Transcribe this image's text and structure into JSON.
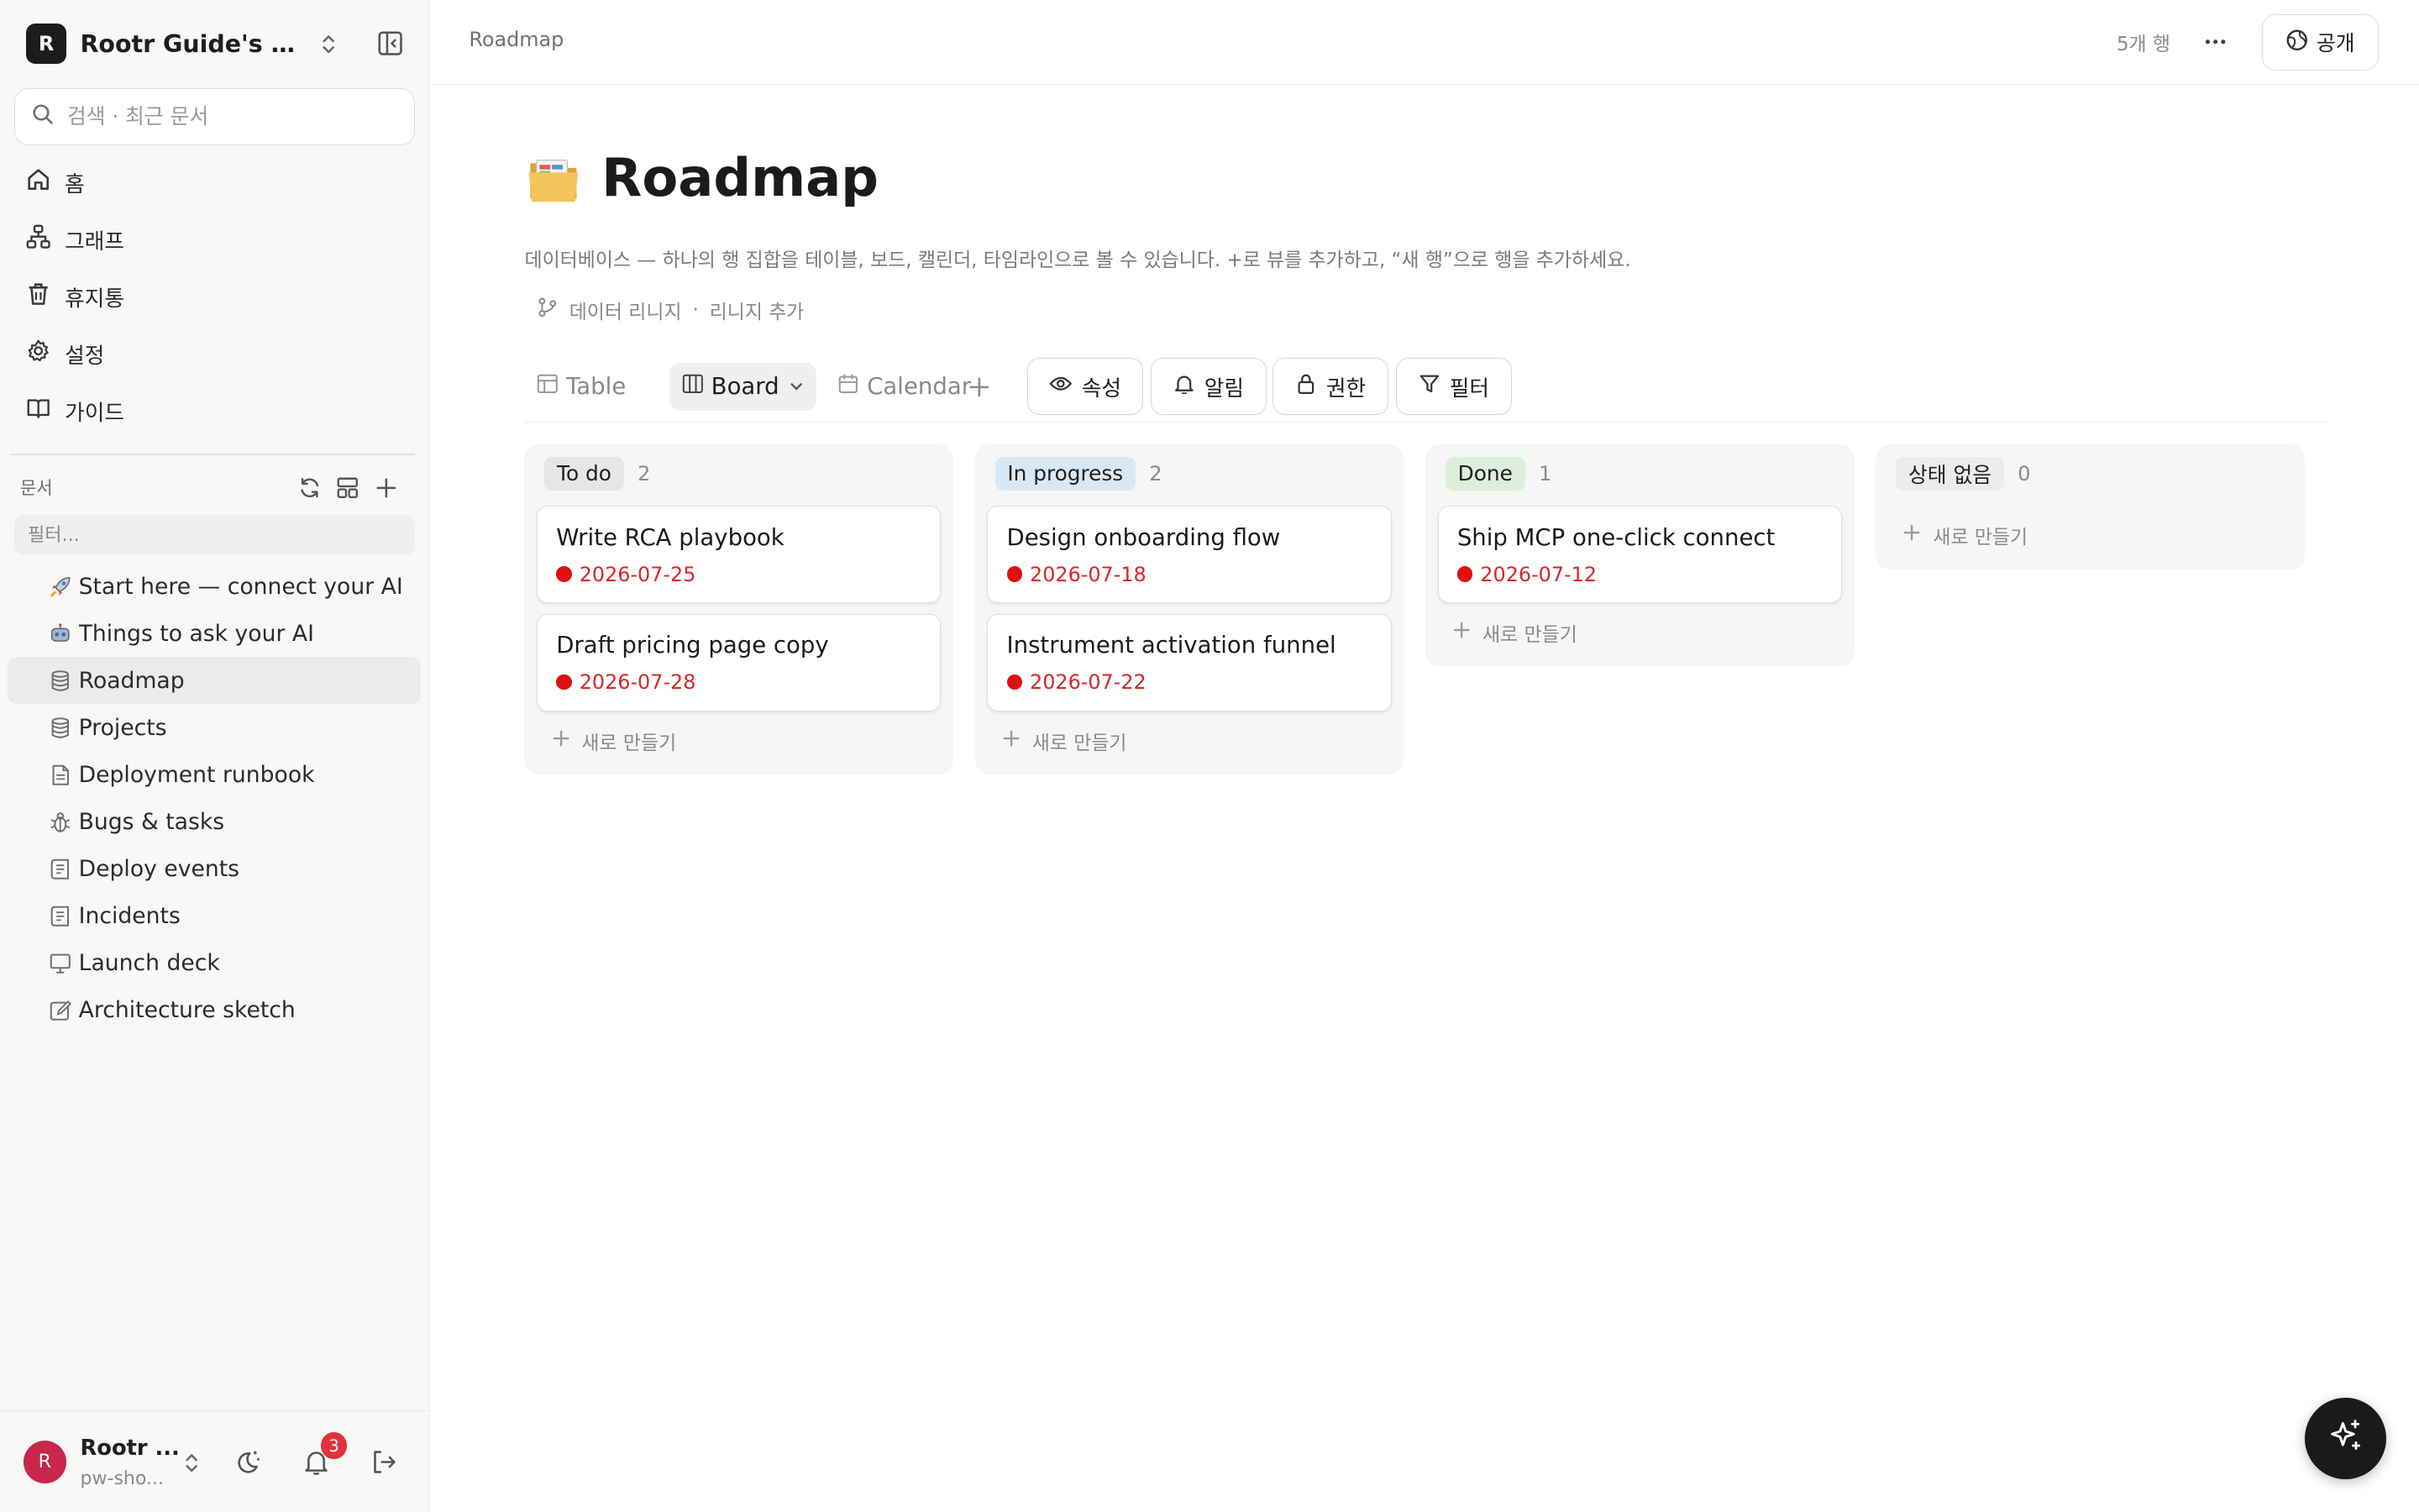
{
  "workspace": {
    "logo_letter": "R",
    "name": "Rootr Guide's Workspace"
  },
  "search": {
    "placeholder": "검색 · 최근 문서"
  },
  "nav": [
    {
      "label": "홈",
      "icon": "home-icon"
    },
    {
      "label": "그래프",
      "icon": "graph-icon"
    },
    {
      "label": "휴지통",
      "icon": "trash-icon"
    },
    {
      "label": "설정",
      "icon": "gear-icon"
    },
    {
      "label": "가이드",
      "icon": "book-icon"
    }
  ],
  "docs": {
    "label": "문서",
    "filter_placeholder": "필터...",
    "items": [
      {
        "label": "Start here — connect your AI",
        "icon": "rocket-icon"
      },
      {
        "label": "Things to ask your AI",
        "icon": "robot-icon"
      },
      {
        "label": "Roadmap",
        "icon": "database-icon",
        "active": true
      },
      {
        "label": "Projects",
        "icon": "database-icon"
      },
      {
        "label": "Deployment runbook",
        "icon": "document-icon"
      },
      {
        "label": "Bugs & tasks",
        "icon": "bug-icon"
      },
      {
        "label": "Deploy events",
        "icon": "log-icon"
      },
      {
        "label": "Incidents",
        "icon": "log-icon"
      },
      {
        "label": "Launch deck",
        "icon": "presentation-icon"
      },
      {
        "label": "Architecture sketch",
        "icon": "sketch-icon"
      }
    ]
  },
  "user": {
    "avatar_letter": "R",
    "name": "Rootr ...",
    "sub": "pw-sho...",
    "notification_count": "3"
  },
  "topbar": {
    "breadcrumb": "Roadmap",
    "row_count": "5개 행",
    "public_label": "공개"
  },
  "page": {
    "title": "Roadmap",
    "emoji": "folder-emoji",
    "description": "데이터베이스 — 하나의 행 집합을 테이블, 보드, 캘린더, 타임라인으로 볼 수 있습니다. +로 뷰를 추가하고, “새 행”으로 행을 추가하세요.",
    "lineage_label": "데이터 리니지",
    "lineage_add": "리니지 추가",
    "lineage_sep": "·"
  },
  "views": {
    "tabs": [
      {
        "label": "Table",
        "icon": "table-icon"
      },
      {
        "label": "Board",
        "icon": "board-icon",
        "active": true
      },
      {
        "label": "Calendar",
        "icon": "calendar-icon"
      }
    ],
    "toolbar": [
      {
        "label": "속성",
        "icon": "eye-icon"
      },
      {
        "label": "알림",
        "icon": "bell-icon"
      },
      {
        "label": "권한",
        "icon": "lock-icon"
      },
      {
        "label": "필터",
        "icon": "filter-icon"
      }
    ]
  },
  "board": {
    "new_label": "새로 만들기",
    "columns": [
      {
        "name": "To do",
        "count": "2",
        "color": "#e6e6e4",
        "cards": [
          {
            "title": "Write RCA playbook",
            "date": "2026-07-25"
          },
          {
            "title": "Draft pricing page copy",
            "date": "2026-07-28"
          }
        ]
      },
      {
        "name": "In progress",
        "count": "2",
        "color": "#d9e8f5",
        "cards": [
          {
            "title": "Design onboarding flow",
            "date": "2026-07-18"
          },
          {
            "title": "Instrument activation funnel",
            "date": "2026-07-22"
          }
        ]
      },
      {
        "name": "Done",
        "count": "1",
        "color": "#dcefdc",
        "cards": [
          {
            "title": "Ship MCP one-click connect",
            "date": "2026-07-12"
          }
        ]
      },
      {
        "name": "상태 없음",
        "count": "0",
        "color": "#ececea",
        "cards": []
      }
    ]
  },
  "colors": {
    "date_red": "#d62828",
    "dot_red": "#e01010",
    "badge_red": "#e0323a",
    "avatar": "#c8264a"
  }
}
